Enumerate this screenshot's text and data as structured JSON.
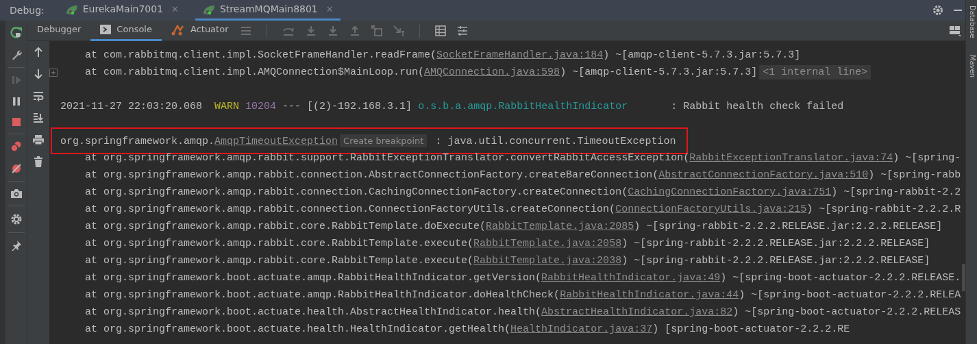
{
  "debug_bar": {
    "label": "Debug:",
    "tabs": [
      {
        "label": "EurekaMain7001",
        "close": "✕",
        "selected": false
      },
      {
        "label": "StreamMQMain8801",
        "close": "✕",
        "selected": true
      }
    ]
  },
  "toolbar": {
    "tabs": [
      {
        "label": "Debugger",
        "kind": "plain",
        "selected": false
      },
      {
        "label": "Console",
        "kind": "console",
        "selected": true
      },
      {
        "label": "Actuator",
        "kind": "actuator",
        "selected": false
      }
    ]
  },
  "right_strip": {
    "items": [
      "Database",
      "Maven"
    ]
  },
  "console": {
    "lines": [
      {
        "kind": "stack",
        "fold": false,
        "highlighted": false,
        "segments": [
          {
            "kind": "plain",
            "text": "at com.rabbitmq.client.impl.SocketFrameHandler.readFrame("
          },
          {
            "kind": "link",
            "text": "SocketFrameHandler.java:184"
          },
          {
            "kind": "plain",
            "text": ") ~[amqp-client-5.7.3.jar:5.7.3]"
          }
        ]
      },
      {
        "kind": "stack",
        "fold": true,
        "highlighted": false,
        "segments": [
          {
            "kind": "plain",
            "text": "at com.rabbitmq.client.impl.AMQConnection$MainLoop.run("
          },
          {
            "kind": "link",
            "text": "AMQConnection.java:598"
          },
          {
            "kind": "plain",
            "text": ") ~[amqp-client-5.7.3.jar:5.7.3]"
          },
          {
            "kind": "hint",
            "text": "<1 internal line>"
          }
        ]
      },
      {
        "kind": "blank",
        "fold": false,
        "highlighted": false
      },
      {
        "kind": "log",
        "fold": false,
        "highlighted": false,
        "segments": [
          {
            "kind": "plain",
            "text": "2021-11-27 22:03:20.068  "
          },
          {
            "kind": "warn",
            "text": "WARN"
          },
          {
            "kind": "pid",
            "text": " 10204"
          },
          {
            "kind": "plain",
            "text": " --- [(2)-192.168.3.1] "
          },
          {
            "kind": "logger",
            "text": "o.s.b.a.amqp.RabbitHealthIndicator"
          },
          {
            "kind": "plain",
            "text": "       : Rabbit health check failed"
          }
        ]
      },
      {
        "kind": "blank",
        "fold": false,
        "highlighted": false
      },
      {
        "kind": "log",
        "fold": false,
        "highlighted": true,
        "segments": [
          {
            "kind": "plain",
            "text": "org.springframework.amqp."
          },
          {
            "kind": "link",
            "text": "AmqpTimeoutException"
          },
          {
            "kind": "hint",
            "text": "Create breakpoint"
          },
          {
            "kind": "plain",
            "text": " : java.util.concurrent.TimeoutException"
          }
        ]
      },
      {
        "kind": "stack",
        "fold": false,
        "highlighted": false,
        "segments": [
          {
            "kind": "plain",
            "text": "at org.springframework.amqp.rabbit.support.RabbitExceptionTranslator.convertRabbitAccessException("
          },
          {
            "kind": "link",
            "text": "RabbitExceptionTranslator.java:74"
          },
          {
            "kind": "plain",
            "text": ") ~[spring-"
          }
        ]
      },
      {
        "kind": "stack",
        "fold": false,
        "highlighted": false,
        "segments": [
          {
            "kind": "plain",
            "text": "at org.springframework.amqp.rabbit.connection.AbstractConnectionFactory.createBareConnection("
          },
          {
            "kind": "link",
            "text": "AbstractConnectionFactory.java:510"
          },
          {
            "kind": "plain",
            "text": ") ~[spring-rabb"
          }
        ]
      },
      {
        "kind": "stack",
        "fold": false,
        "highlighted": false,
        "segments": [
          {
            "kind": "plain",
            "text": "at org.springframework.amqp.rabbit.connection.CachingConnectionFactory.createConnection("
          },
          {
            "kind": "link",
            "text": "CachingConnectionFactory.java:751"
          },
          {
            "kind": "plain",
            "text": ") ~[spring-rabbit-2.2"
          }
        ]
      },
      {
        "kind": "stack",
        "fold": false,
        "highlighted": false,
        "segments": [
          {
            "kind": "plain",
            "text": "at org.springframework.amqp.rabbit.connection.ConnectionFactoryUtils.createConnection("
          },
          {
            "kind": "link",
            "text": "ConnectionFactoryUtils.java:215"
          },
          {
            "kind": "plain",
            "text": ") ~[spring-rabbit-2.2.2.R"
          }
        ]
      },
      {
        "kind": "stack",
        "fold": false,
        "highlighted": false,
        "segments": [
          {
            "kind": "plain",
            "text": "at org.springframework.amqp.rabbit.core.RabbitTemplate.doExecute("
          },
          {
            "kind": "link",
            "text": "RabbitTemplate.java:2085"
          },
          {
            "kind": "plain",
            "text": ") ~[spring-rabbit-2.2.2.RELEASE.jar:2.2.2.RELEASE]"
          }
        ]
      },
      {
        "kind": "stack",
        "fold": false,
        "highlighted": false,
        "segments": [
          {
            "kind": "plain",
            "text": "at org.springframework.amqp.rabbit.core.RabbitTemplate.execute("
          },
          {
            "kind": "link",
            "text": "RabbitTemplate.java:2058"
          },
          {
            "kind": "plain",
            "text": ") ~[spring-rabbit-2.2.2.RELEASE.jar:2.2.2.RELEASE]"
          }
        ]
      },
      {
        "kind": "stack",
        "fold": false,
        "highlighted": false,
        "segments": [
          {
            "kind": "plain",
            "text": "at org.springframework.amqp.rabbit.core.RabbitTemplate.execute("
          },
          {
            "kind": "link",
            "text": "RabbitTemplate.java:2038"
          },
          {
            "kind": "plain",
            "text": ") ~[spring-rabbit-2.2.2.RELEASE.jar:2.2.2.RELEASE]"
          }
        ]
      },
      {
        "kind": "stack",
        "fold": false,
        "highlighted": false,
        "segments": [
          {
            "kind": "plain",
            "text": "at org.springframework.boot.actuate.amqp.RabbitHealthIndicator.getVersion("
          },
          {
            "kind": "link",
            "text": "RabbitHealthIndicator.java:49"
          },
          {
            "kind": "plain",
            "text": ") ~[spring-boot-actuator-2.2.2.RELEASE."
          }
        ]
      },
      {
        "kind": "stack",
        "fold": false,
        "highlighted": false,
        "segments": [
          {
            "kind": "plain",
            "text": "at org.springframework.boot.actuate.amqp.RabbitHealthIndicator.doHealthCheck("
          },
          {
            "kind": "link",
            "text": "RabbitHealthIndicator.java:44"
          },
          {
            "kind": "plain",
            "text": ") ~[spring-boot-actuator-2.2.2.RELEA"
          }
        ]
      },
      {
        "kind": "stack",
        "fold": false,
        "highlighted": false,
        "segments": [
          {
            "kind": "plain",
            "text": "at org.springframework.boot.actuate.health.AbstractHealthIndicator.health("
          },
          {
            "kind": "link",
            "text": "AbstractHealthIndicator.java:82"
          },
          {
            "kind": "plain",
            "text": ") ~[spring-boot-actuator-2.2.2.RELEAS"
          }
        ]
      },
      {
        "kind": "stack",
        "fold": false,
        "highlighted": false,
        "segments": [
          {
            "kind": "plain",
            "text": "at org.springframework.boot.actuate.health.HealthIndicator.getHealth("
          },
          {
            "kind": "link",
            "text": "HealthIndicator.java:37"
          },
          {
            "kind": "plain",
            "text": ") [spring-boot-actuator-2.2.2.RE"
          }
        ]
      }
    ]
  }
}
